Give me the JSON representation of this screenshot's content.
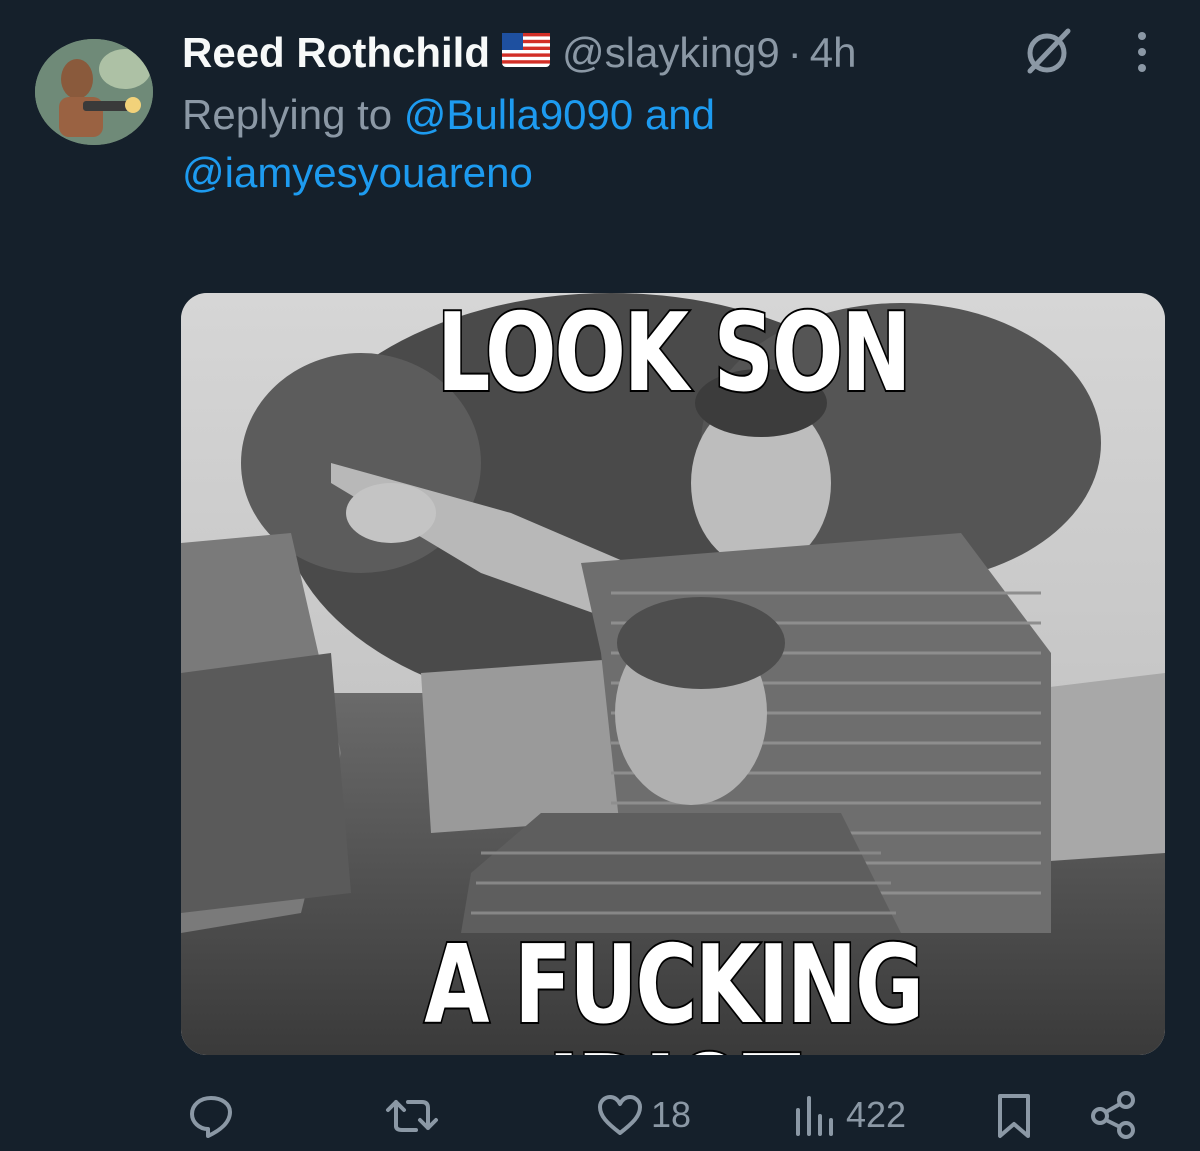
{
  "tweet": {
    "author_name": "Reed Rothchild",
    "flag_emoji": "🇺🇸",
    "handle": "@slayking9",
    "separator": "·",
    "time": "4h",
    "replying_prefix": "Replying to",
    "reply_mentions": [
      "@Bulla9090",
      "@iamyesyouareno"
    ],
    "reply_conjunction": "and"
  },
  "media": {
    "meme_top_text": "LOOK SON",
    "meme_bottom_text": "A FUCKING IDIOT"
  },
  "actions": {
    "reply_icon": "reply-icon",
    "retweet_icon": "retweet-icon",
    "like_icon": "heart-icon",
    "like_count": "18",
    "views_icon": "views-icon",
    "view_count": "422",
    "bookmark_icon": "bookmark-icon",
    "share_icon": "share-icon"
  },
  "colors": {
    "background": "#15202b",
    "accent": "#1d9bf0",
    "secondary_text": "#8b98a5",
    "primary_text": "#f7f9f9"
  }
}
